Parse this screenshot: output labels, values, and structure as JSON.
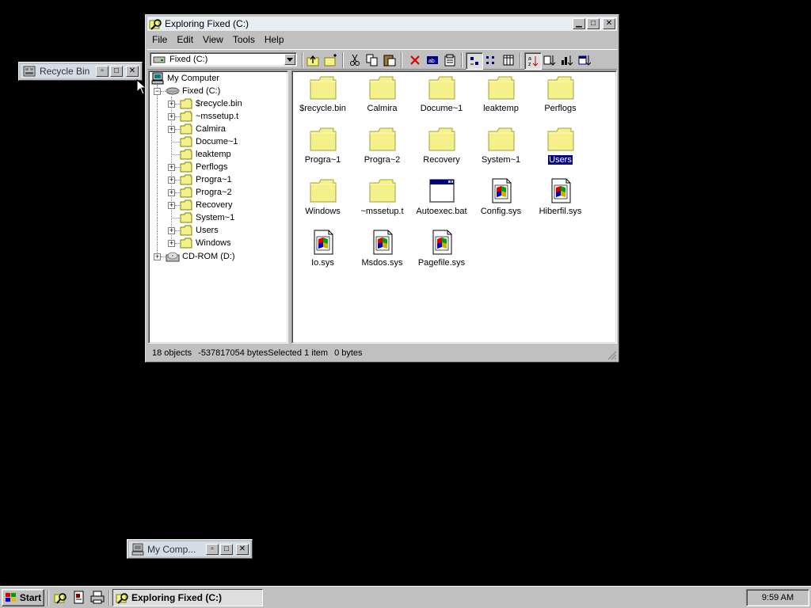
{
  "explorer": {
    "title": "Exploring Fixed (C:)",
    "menus": [
      "File",
      "Edit",
      "View",
      "Tools",
      "Help"
    ],
    "drive_combo": "Fixed (C:)",
    "status_left": "18 objects",
    "status_mid": "-537817054 bytes",
    "status_right": "Selected 1 item",
    "status_size": "0 bytes"
  },
  "tree": {
    "root": "My Computer",
    "drive": "Fixed (C:)",
    "folders": [
      "$recycle.bin",
      "~mssetup.t",
      "Calmira",
      "Docume~1",
      "leaktemp",
      "Perflogs",
      "Progra~1",
      "Progra~2",
      "Recovery",
      "System~1",
      "Users",
      "Windows"
    ],
    "cdrom": "CD-ROM (D:)"
  },
  "items": [
    {
      "name": "$recycle.bin",
      "type": "folder"
    },
    {
      "name": "Calmira",
      "type": "folder"
    },
    {
      "name": "Docume~1",
      "type": "folder"
    },
    {
      "name": "leaktemp",
      "type": "folder"
    },
    {
      "name": "Perflogs",
      "type": "folder"
    },
    {
      "name": "Progra~1",
      "type": "folder"
    },
    {
      "name": "Progra~2",
      "type": "folder"
    },
    {
      "name": "Recovery",
      "type": "folder"
    },
    {
      "name": "System~1",
      "type": "folder"
    },
    {
      "name": "Users",
      "type": "folder",
      "selected": true
    },
    {
      "name": "Windows",
      "type": "folder"
    },
    {
      "name": "~mssetup.t",
      "type": "folder"
    },
    {
      "name": "Autoexec.bat",
      "type": "batch"
    },
    {
      "name": "Config.sys",
      "type": "sysfile"
    },
    {
      "name": "Hiberfil.sys",
      "type": "sysfile"
    },
    {
      "name": "Io.sys",
      "type": "sysfile"
    },
    {
      "name": "Msdos.sys",
      "type": "sysfile"
    },
    {
      "name": "Pagefile.sys",
      "type": "sysfile"
    }
  ],
  "minimized": {
    "recycle": "Recycle Bin",
    "mycomp": "My Comp..."
  },
  "taskbar": {
    "start": "Start",
    "task": "Exploring Fixed (C:)",
    "clock": "9:59 AM"
  },
  "colors": {
    "desktop": "#000000",
    "face": "#c0c0c0",
    "selection": "#000080",
    "folder": "#f4f08a"
  }
}
